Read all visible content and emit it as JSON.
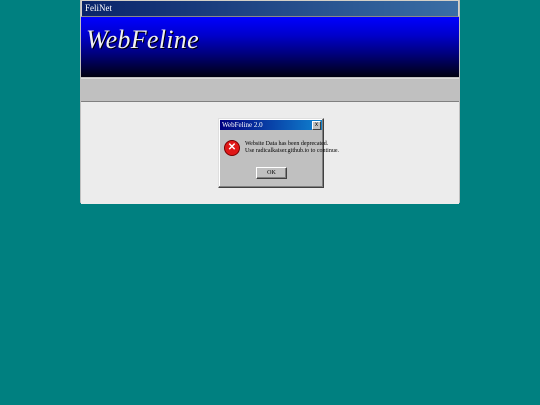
{
  "window": {
    "title": "FeliNet"
  },
  "banner": {
    "logo": "WebFeline"
  },
  "dialog": {
    "title": "WebFeline 2.0",
    "close_label": "x",
    "icon": "error-icon",
    "icon_glyph": "✕",
    "message_lines": [
      "Website Data has been deprecated.",
      "Use radicalkaiser.github.io to continue."
    ],
    "ok_label": "OK"
  },
  "colors": {
    "desktop": "#008080",
    "error": "#e01818"
  }
}
